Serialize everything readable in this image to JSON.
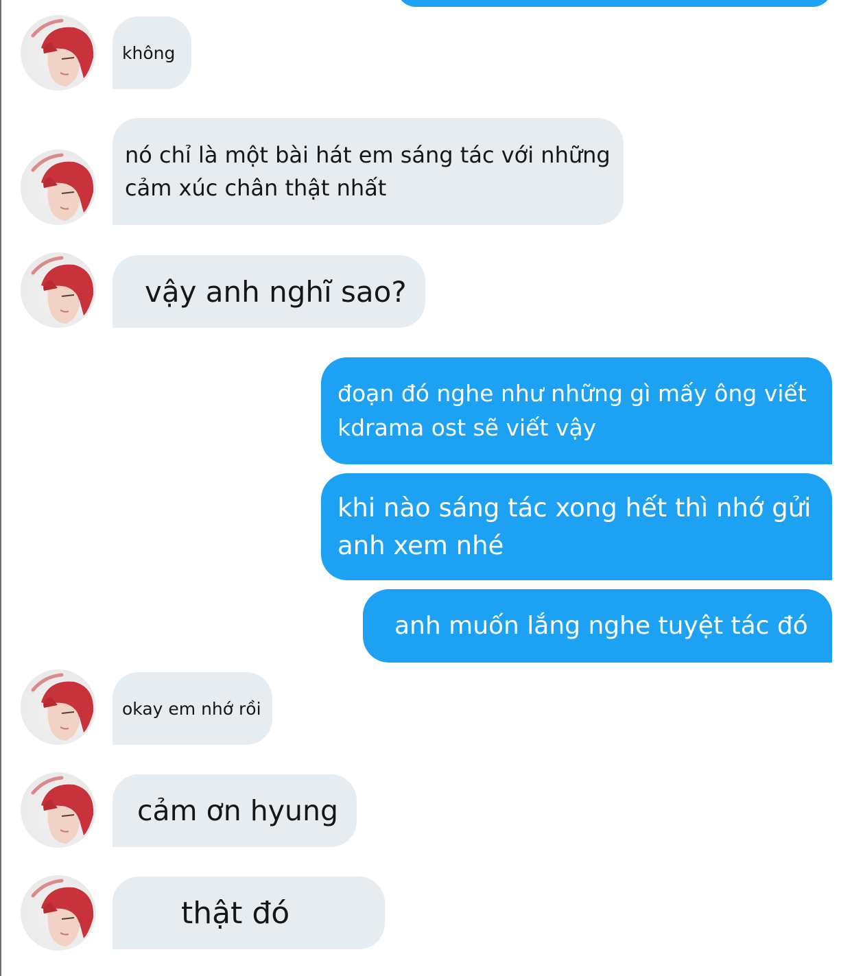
{
  "conversation": {
    "colors": {
      "incoming_bg": "#e6ecf0",
      "outgoing_bg": "#1da1f2",
      "incoming_text": "#14171a",
      "outgoing_text": "#ffffff"
    },
    "messages": [
      {
        "from": "other",
        "text": "không"
      },
      {
        "from": "other",
        "text": "nó chỉ là một bài hát em sáng tác với những cảm xúc chân thật nhất"
      },
      {
        "from": "other",
        "text": "vậy anh nghĩ sao?"
      },
      {
        "from": "me",
        "text": "đoạn đó nghe như những gì mấy ông viết kdrama ost sẽ viết vậy"
      },
      {
        "from": "me",
        "text": "khi nào sáng tác xong hết thì nhớ gửi anh xem nhé"
      },
      {
        "from": "me",
        "text": "anh muốn lắng nghe tuyệt tác đó"
      },
      {
        "from": "other",
        "text": "okay em nhớ rồi"
      },
      {
        "from": "other",
        "text": "cảm ơn hyung"
      },
      {
        "from": "other",
        "text": "thật đó"
      }
    ]
  }
}
